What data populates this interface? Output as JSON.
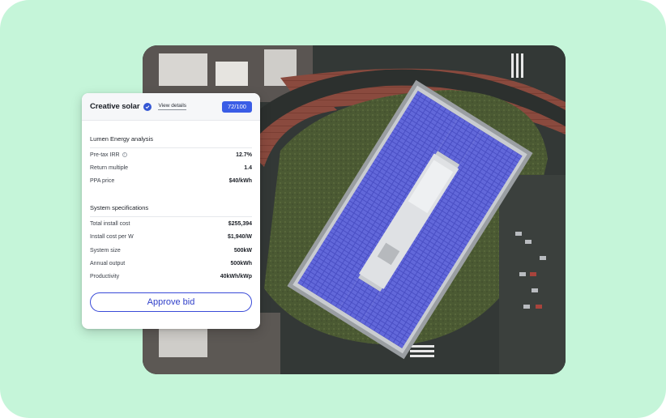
{
  "card": {
    "vendor_name": "Creative solar",
    "verified_icon": "check-badge-icon",
    "view_details_label": "View details",
    "score_badge": "72/100"
  },
  "analysis": {
    "title": "Lumen Energy analysis",
    "rows": [
      {
        "label": "Pre-tax IRR",
        "value": "12.7%",
        "info_icon": "info-icon"
      },
      {
        "label": "Return multiple",
        "value": "1.4"
      },
      {
        "label": "PPA price",
        "value": "$40/kWh"
      }
    ]
  },
  "specs": {
    "title": "System specifications",
    "rows": [
      {
        "label": "Total install cost",
        "value": "$255,394"
      },
      {
        "label": "Install cost per W",
        "value": "$1,940/W"
      },
      {
        "label": "System size",
        "value": "500kW"
      },
      {
        "label": "Annual output",
        "value": "500kWh"
      },
      {
        "label": "Productivity",
        "value": "40kWh/kWp"
      }
    ]
  },
  "actions": {
    "approve_label": "Approve bid"
  },
  "colors": {
    "backdrop": "#c5f5d9",
    "accent": "#3a5de6",
    "button_text": "#2f3fc9",
    "solar_panel": "#5b5fd0"
  }
}
